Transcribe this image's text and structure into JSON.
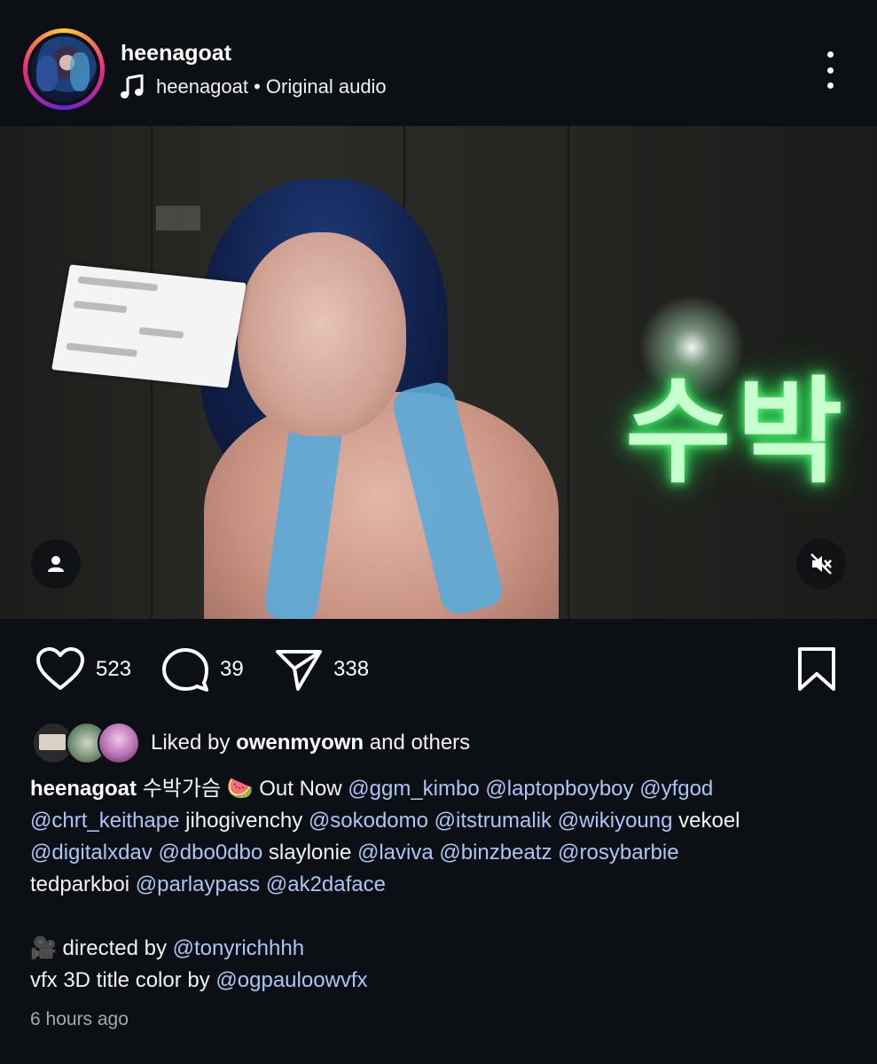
{
  "post": {
    "username": "heenagoat",
    "audio_label": "heenagoat • Original audio",
    "icons": {
      "music": "music-note-icon",
      "more": "more-vertical-icon"
    }
  },
  "media": {
    "overlay_text": "수박"
  },
  "actions": {
    "like_count": "523",
    "comment_count": "39",
    "share_count": "338"
  },
  "likes": {
    "prefix": "Liked by ",
    "user": "owenmyown",
    "suffix": " and others"
  },
  "caption": {
    "username": "heenagoat",
    "line1_text": " 수박가슴 🍉 Out Now ",
    "m_ggm_kimbo": "@ggm_kimbo",
    "m_laptopboyboy": "@laptopboyboy",
    "m_yfgod": "@yfgod",
    "m_chrt_keithape": "@chrt_keithape",
    "t_jihogivenchy": " jihogivenchy ",
    "m_sokodomo": "@sokodomo",
    "m_itstrumalik": "@itstrumalik",
    "m_wikiyoung": "@wikiyoung",
    "t_vekoel": " vekoel",
    "m_digitalxdav": "@digitalxdav",
    "m_dbo0dbo": "@dbo0dbo",
    "t_slaylonie": " slaylonie ",
    "m_laviva": "@laviva",
    "m_binzbeatz": "@binzbeatz",
    "m_rosybarbie": "@rosybarbie",
    "t_tedparkboi": "tedparkboi ",
    "m_parlaypass": "@parlaypass",
    "m_ak2daface": "@ak2daface",
    "directed_by": "🎥 directed by ",
    "m_tonyrichhhh": "@tonyrichhhh",
    "vfx_text": "vfx 3D title color by ",
    "m_ogpauloowvfx": "@ogpauloowvfx"
  },
  "timestamp": "6 hours ago",
  "colors": {
    "background": "#0c0f14",
    "mention": "#a9c6f7",
    "neon": "#5dff7a"
  }
}
